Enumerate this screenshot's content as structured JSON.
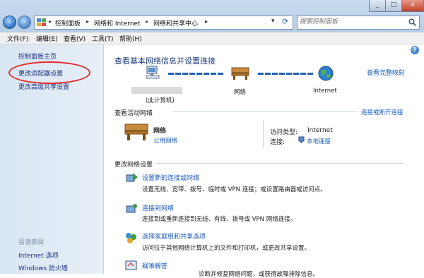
{
  "window": {
    "min_glyph": "_",
    "max_glyph": "□",
    "close_glyph": "x"
  },
  "nav": {
    "back_glyph": "‹",
    "forward_glyph": "›"
  },
  "address": {
    "crumbs": [
      "控制面板",
      "网络和 Internet",
      "网络和共享中心"
    ],
    "refresh_glyph": "⟳",
    "dropdown_glyph": "▾"
  },
  "search": {
    "placeholder": "搜索控制面板"
  },
  "menu": {
    "file": "文件(F)",
    "edit": "编辑(E)",
    "view": "查看(V)",
    "tools": "工具(T)",
    "help": "帮助(H)"
  },
  "sidebar": {
    "items": [
      "控制面板主页",
      "更改适配器设置",
      "更改高级共享设置"
    ],
    "see_also_title": "另请参阅",
    "see_also": [
      "Internet 选项",
      "Windows 防火墙"
    ]
  },
  "main": {
    "help_glyph": "?",
    "title": "查看基本网络信息并设置连接",
    "view_full_map": "查看完整映射",
    "map": {
      "computer_label": "(此计算机)",
      "network_label": "网络",
      "internet_label": "Internet"
    },
    "active_heading": "查看活动网络",
    "connect_or_disconnect": "连接或断开连接",
    "network": {
      "name": "网络",
      "type": "公用网络"
    },
    "access_type_label": "访问类型:",
    "access_type_value": "Internet",
    "connections_label": "连接:",
    "connections_value": "本地连接",
    "change_heading": "更改网络设置",
    "tasks": [
      {
        "title": "设置新的连接或网络",
        "desc": "设置无线、宽带、拨号、临时或 VPN 连接；或设置路由器或访问点。"
      },
      {
        "title": "连接到网络",
        "desc": "连接到或重新连接到无线、有线、拨号或 VPN 网络连接。"
      },
      {
        "title": "选择家庭组和共享选项",
        "desc": "访问位于其他网络计算机上的文件和打印机，或更改共享设置。"
      },
      {
        "title": "疑难解答",
        "desc": "诊断并修复网络问题，或获得故障排除信息。"
      }
    ]
  },
  "colors": {
    "link": "#1a5bbd",
    "heading": "#1a3b7a",
    "annotation": "#e52b2b"
  }
}
